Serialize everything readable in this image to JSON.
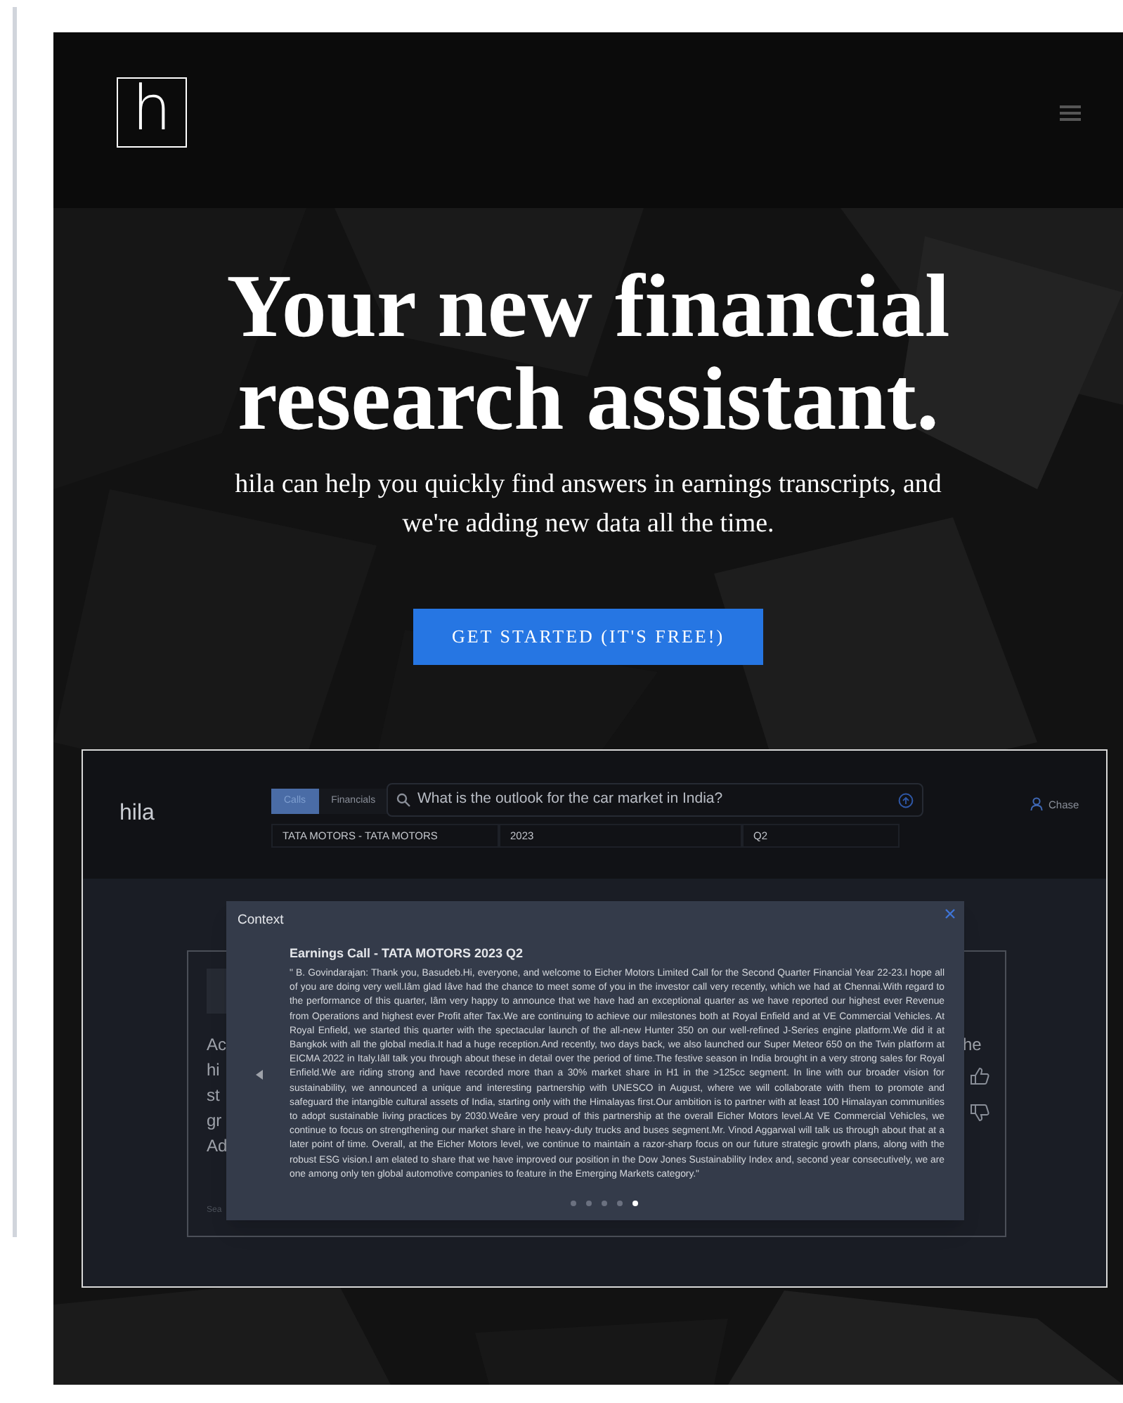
{
  "logo": {
    "letter": "h"
  },
  "hero": {
    "headline": "Your new financial research assistant.",
    "subtitle": "hila can help you quickly find answers in earnings transcripts, and we're adding new data all the time.",
    "cta": "GET STARTED (IT'S FREE!)"
  },
  "preview": {
    "brand": "hila",
    "tabs": [
      {
        "label": "Calls",
        "selected": true
      },
      {
        "label": "Financials",
        "selected": false
      }
    ],
    "search": {
      "value": "What is the outlook for the car market in India?"
    },
    "user": "Chase",
    "filters": [
      "TATA MOTORS - TATA MOTORS",
      "2023",
      "Q2"
    ],
    "behind": {
      "left": [
        "Ac",
        "hi",
        "st",
        "gr",
        "Ad"
      ],
      "right": "he",
      "footer": "Sea"
    },
    "modal": {
      "title": "Context",
      "heading": "Earnings Call - TATA MOTORS 2023 Q2",
      "text": "\" B. Govindarajan: Thank you, Basudeb.Hi, everyone, and welcome to Eicher Motors Limited Call for the Second Quarter Financial Year 22-23.I hope all of you are doing very well.Iâm glad Iâve had the chance to meet some of you in the investor call very recently, which we had at Chennai.With regard to the performance of this quarter, Iâm very happy to announce that we have had an exceptional quarter as we have reported our highest ever Revenue from Operations and highest ever Profit after Tax.We are continuing to achieve our milestones both at Royal Enfield and at VE Commercial Vehicles. At Royal Enfield, we started this quarter with the spectacular launch of the all-new Hunter 350 on our well-refined J-Series engine platform.We did it at Bangkok with all the global media.It had a huge reception.And recently, two days back, we also launched our Super Meteor 650 on the Twin platform at EICMA 2022 in Italy.Iâll talk you through about these in detail over the period of time.The festive season in India brought in a very strong sales for Royal Enfield.We are riding strong and have recorded more than a 30% market share in H1 in the >125cc segment. In line with our broader vision for sustainability, we announced a unique and interesting partnership with UNESCO in August, where we will collaborate with them to promote and safeguard the intangible cultural assets of India, starting only with the Himalayas first.Our ambition is to partner with at least 100 Himalayan communities to adopt sustainable living practices by 2030.Weâre very proud of this partnership at the overall Eicher Motors level.At VE Commercial Vehicles, we continue to focus on strengthening our market share in the heavy-duty trucks and buses segment.Mr. Vinod Aggarwal will talk us through about that at a later point of time. Overall, at the Eicher Motors level, we continue to maintain a razor-sharp focus on our future strategic growth plans, along with the robust ESG vision.I am elated to share that we have improved our position in the Dow Jones Sustainability Index and, second year consecutively, we are one among only ten global automotive companies to feature in the Emerging Markets category.\"",
      "dots": [
        {
          "selected": false
        },
        {
          "selected": false
        },
        {
          "selected": false
        },
        {
          "selected": false
        },
        {
          "selected": true
        }
      ]
    }
  }
}
